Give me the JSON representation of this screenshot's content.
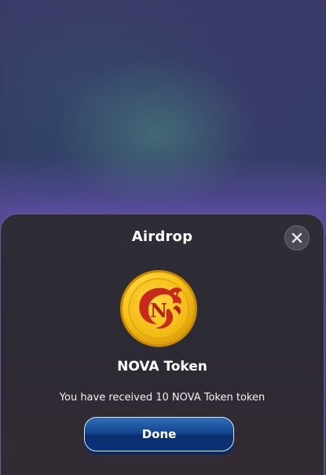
{
  "modal": {
    "title": "Airdrop",
    "close_icon": "close-icon",
    "token_icon": "nova-token-coin-icon",
    "token_name": "NOVA Token",
    "message": "You have received 10 NOVA Token token",
    "done_label": "Done"
  },
  "colors": {
    "sheet_background": "#2e2d36",
    "sheet_border": "#a082e6",
    "button_primary": "#14468f",
    "coin_gold": "#f5c518",
    "coin_red": "#c8281e"
  }
}
